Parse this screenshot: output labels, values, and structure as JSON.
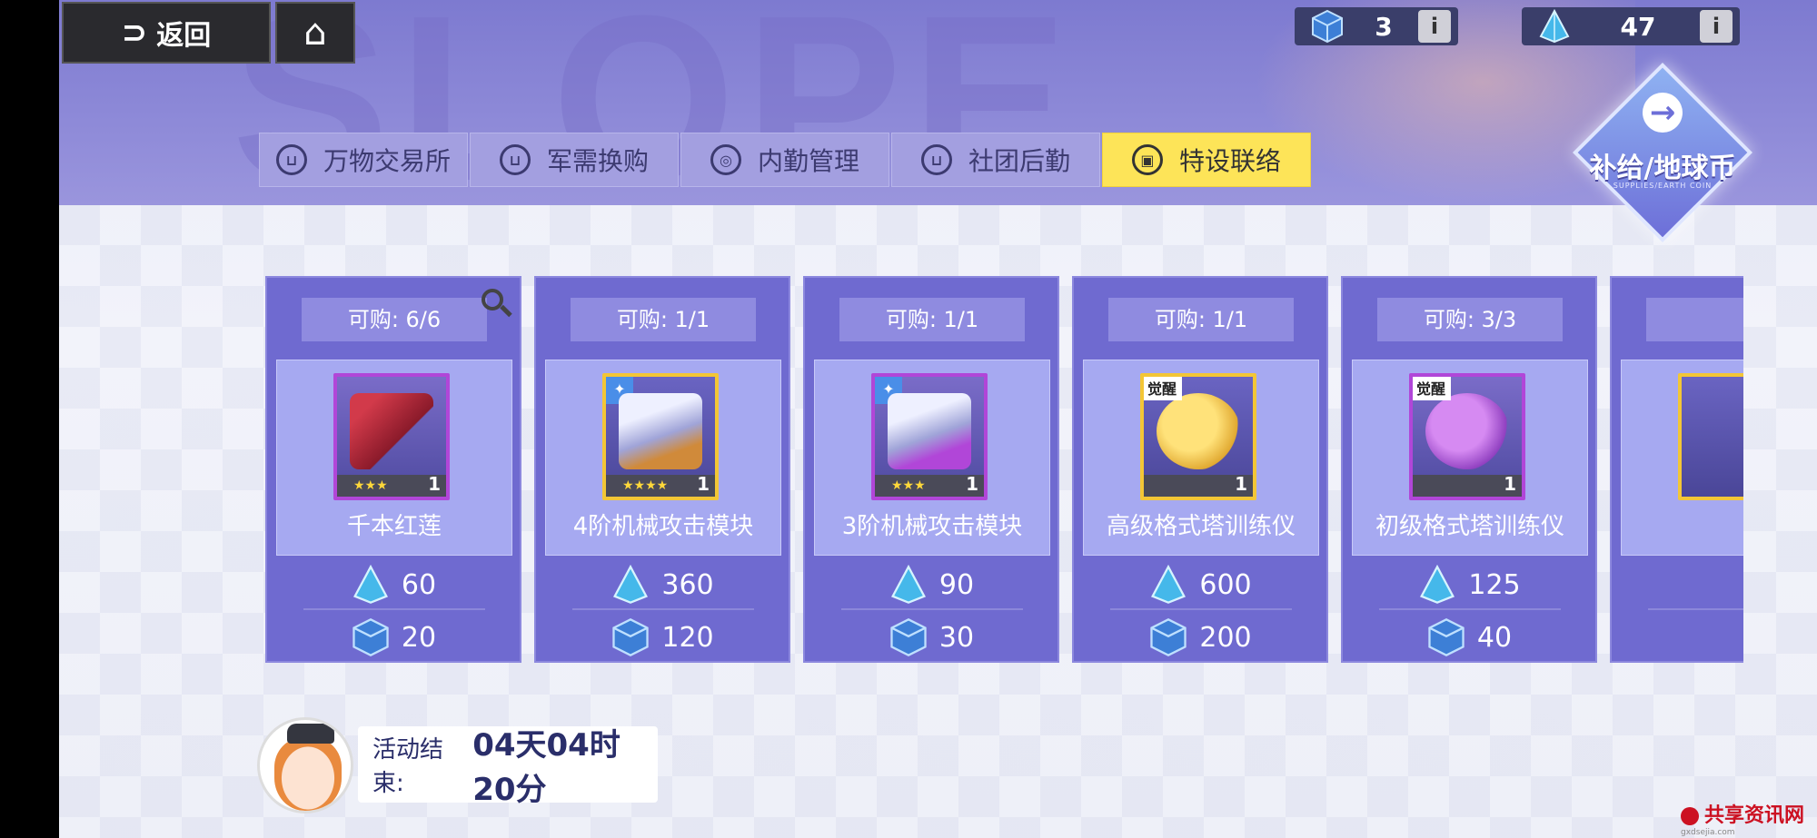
{
  "topbar": {
    "back_label": "返回",
    "currencies": [
      {
        "icon": "cube-icon",
        "value": "3"
      },
      {
        "icon": "crystal-icon",
        "value": "47"
      }
    ],
    "info_label": "i"
  },
  "header": {
    "watermark": "SLOPE"
  },
  "tabs": [
    {
      "label": "万物交易所",
      "icon": "cart-icon",
      "active": false
    },
    {
      "label": "军需换购",
      "icon": "cart-icon",
      "active": false
    },
    {
      "label": "内勤管理",
      "icon": "planet-icon",
      "active": false
    },
    {
      "label": "社团后勤",
      "icon": "cart-icon",
      "active": false
    },
    {
      "label": "特设联络",
      "icon": "lock-icon",
      "active": true
    }
  ],
  "supply_badge": {
    "title": "补给/地球币",
    "subtitle": "SUPPLIES/EARTH COIN"
  },
  "cards": [
    {
      "quota": "可购: 6/6",
      "name": "千本红莲",
      "stars": "★★★",
      "qty": "1",
      "rarity": "purple",
      "prices": [
        "60",
        "20"
      ]
    },
    {
      "quota": "可购: 1/1",
      "name": "4阶机械攻击模块",
      "stars": "★★★★",
      "qty": "1",
      "rarity": "gold",
      "prices": [
        "360",
        "120"
      ]
    },
    {
      "quota": "可购: 1/1",
      "name": "3阶机械攻击模块",
      "stars": "★★★",
      "qty": "1",
      "rarity": "purple",
      "prices": [
        "90",
        "30"
      ]
    },
    {
      "quota": "可购: 1/1",
      "name": "高级格式塔训练仪",
      "stars": "",
      "qty": "1",
      "rarity": "gold",
      "tag": "觉醒",
      "prices": [
        "600",
        "200"
      ]
    },
    {
      "quota": "可购: 3/3",
      "name": "初级格式塔训练仪",
      "stars": "",
      "qty": "1",
      "rarity": "purple",
      "tag": "觉醒",
      "prices": [
        "125",
        "40"
      ]
    }
  ],
  "footer": {
    "timer_label": "活动结束:",
    "timer_value": "04天04时20分"
  },
  "watermark": {
    "text": "共享资讯网",
    "url": "gxdsejia.com"
  },
  "colors": {
    "active_tab": "#fde458",
    "card_bg": "#6f6ad0",
    "header": "#8e8ad8"
  }
}
